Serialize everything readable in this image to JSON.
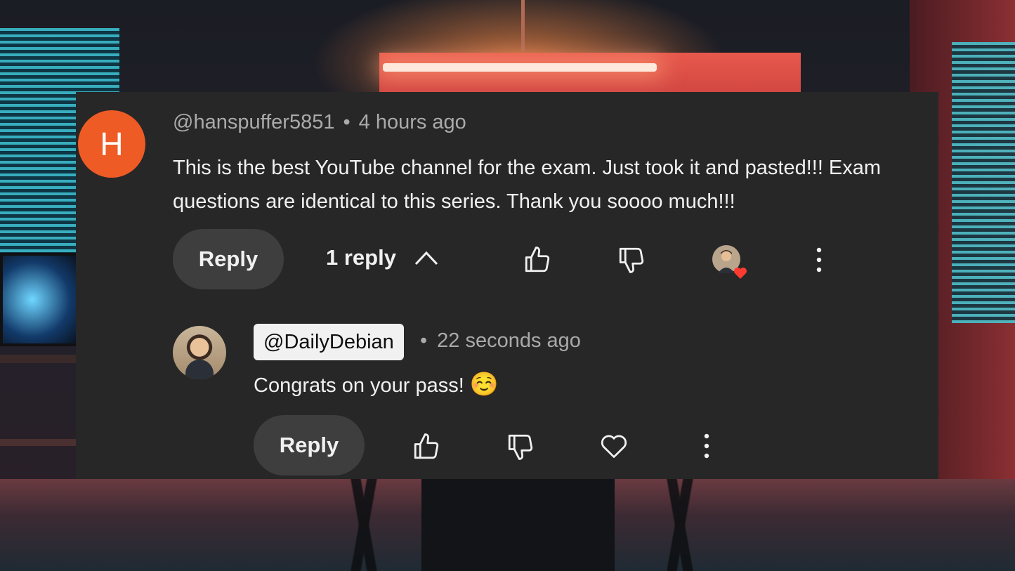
{
  "comment": {
    "avatar_letter": "H",
    "avatar_color": "#ef5b25",
    "author": "@hanspuffer5851",
    "separator": "•",
    "time": "4 hours ago",
    "text": "This is the best YouTube channel for the exam. Just took it and pasted!!! Exam questions are identical to this series. Thank you soooo much!!!",
    "reply_label": "Reply",
    "replies_toggle_label": "1 reply",
    "icons": [
      "thumb-up-icon",
      "thumb-down-icon",
      "creator-heart-icon",
      "more-vert-icon",
      "chevron-up-icon"
    ]
  },
  "reply": {
    "author": "@DailyDebian",
    "separator": "•",
    "time": "22 seconds ago",
    "text": "Congrats on your pass!",
    "emoji": "☺️",
    "reply_label": "Reply",
    "icons": [
      "thumb-up-icon",
      "thumb-down-icon",
      "heart-icon",
      "more-vert-icon"
    ]
  },
  "colors": {
    "card_bg": "#272727",
    "button_bg": "#3e3e3e",
    "text_primary": "#f1f1f1",
    "text_secondary": "#aaaaaa",
    "heart_red": "#ff3b30"
  }
}
